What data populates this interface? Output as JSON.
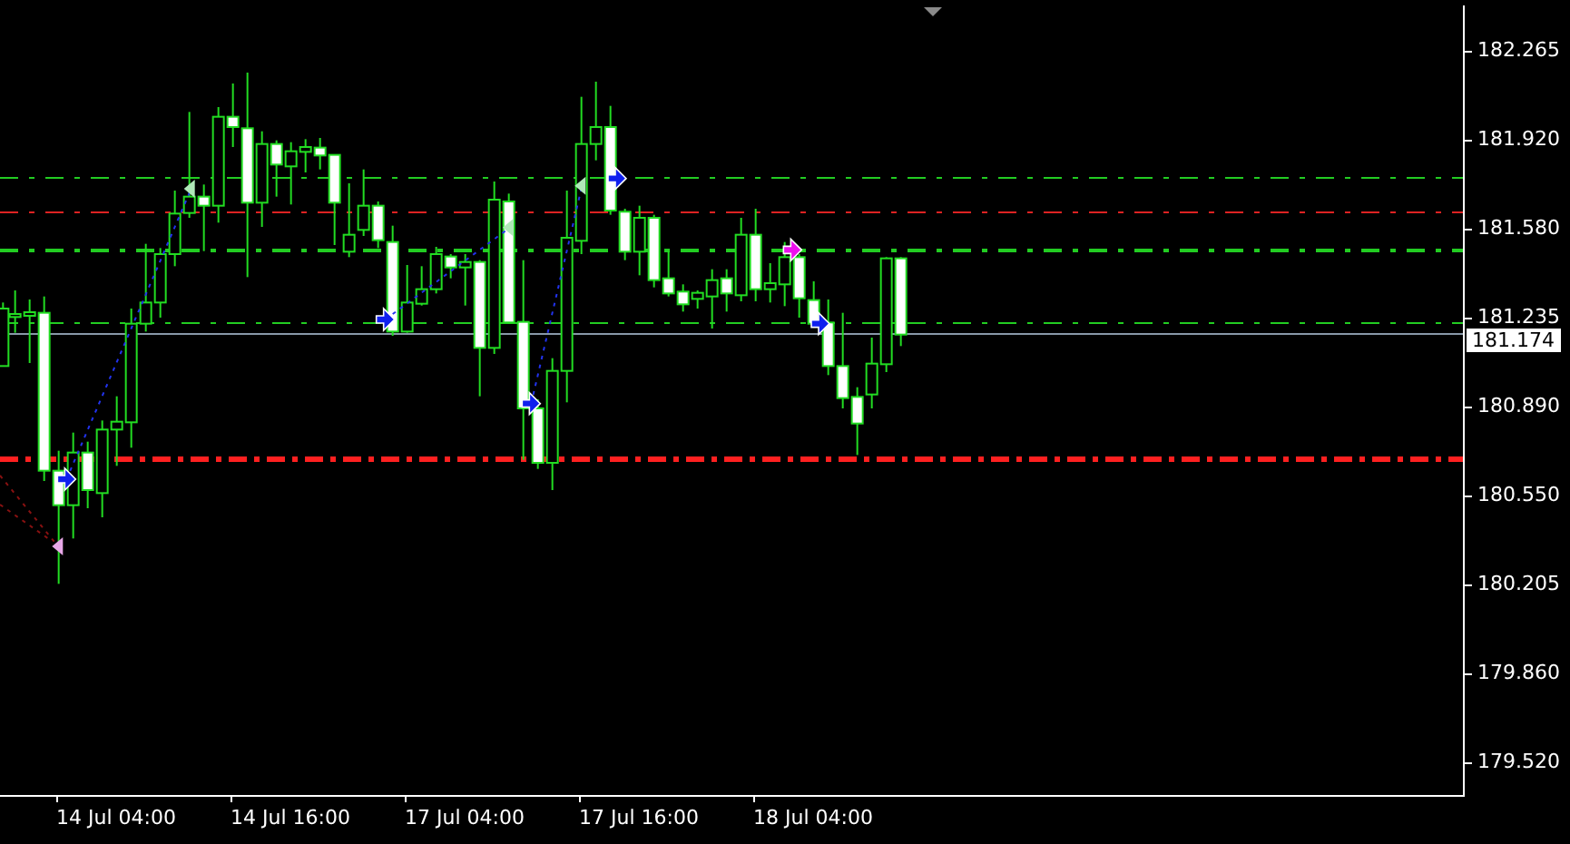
{
  "price_axis": {
    "labels": [
      "182.265",
      "181.920",
      "181.580",
      "181.235",
      "180.890",
      "180.550",
      "180.205",
      "179.860",
      "179.520"
    ],
    "current_price": "181.174"
  },
  "time_axis": {
    "labels": [
      "14 Jul 04:00",
      "14 Jul 16:00",
      "17 Jul 04:00",
      "17 Jul 16:00",
      "18 Jul 04:00"
    ]
  }
}
